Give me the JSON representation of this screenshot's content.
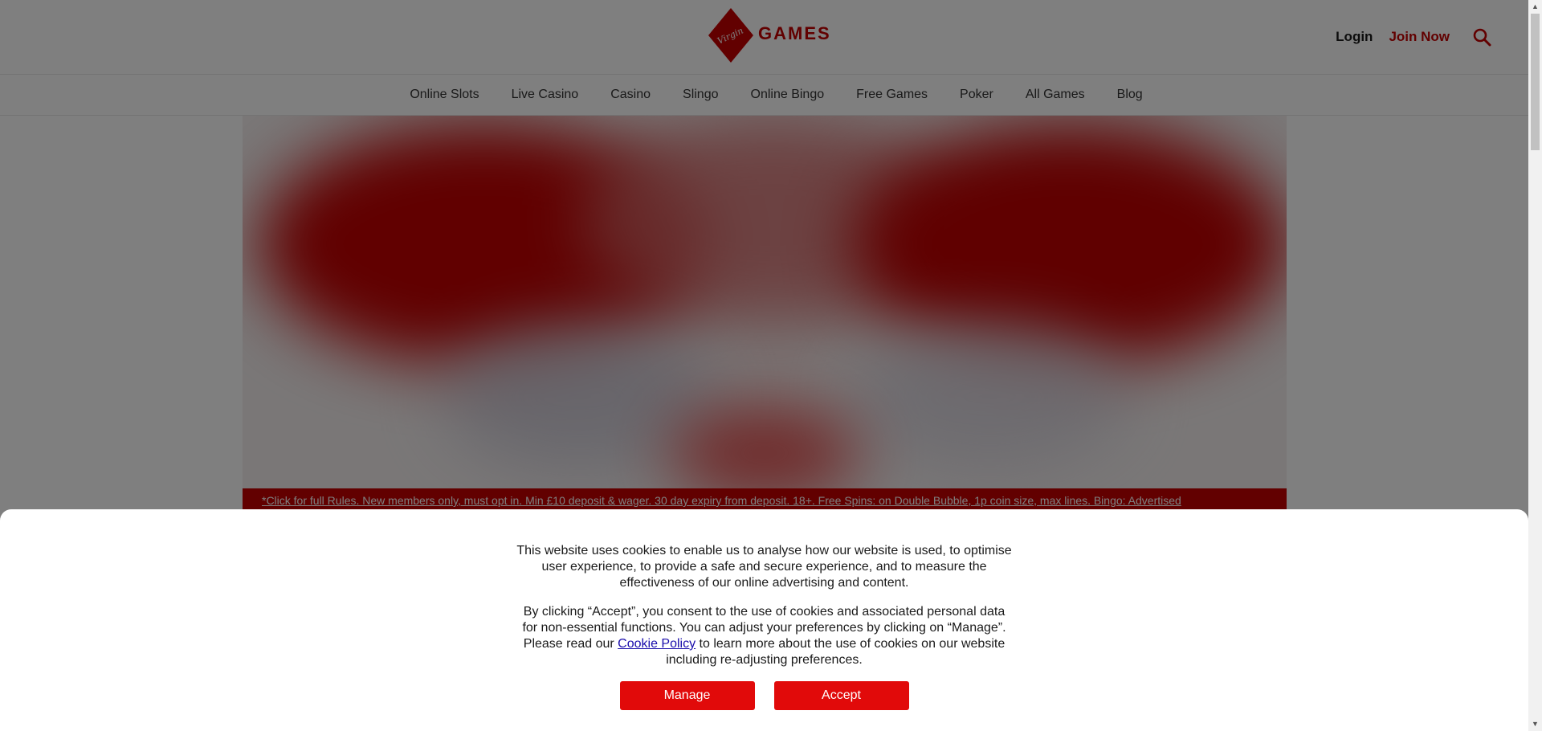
{
  "header": {
    "logo_script": "Virgin",
    "logo_text": "GAMES",
    "login_label": "Login",
    "join_label": "Join Now"
  },
  "nav": {
    "items": [
      {
        "label": "Online Slots"
      },
      {
        "label": "Live Casino"
      },
      {
        "label": "Casino"
      },
      {
        "label": "Slingo"
      },
      {
        "label": "Online Bingo"
      },
      {
        "label": "Free Games"
      },
      {
        "label": "Poker"
      },
      {
        "label": "All Games"
      },
      {
        "label": "Blog"
      }
    ]
  },
  "promo": {
    "text": "*Click for full Rules. New members only, must opt in. Min £10 deposit & wager. 30 day expiry from deposit. 18+. Free Spins: on Double Bubble, 1p coin size, max lines. Bingo: Advertised"
  },
  "cookie": {
    "para1": "This website uses cookies to enable us to analyse how our website is used, to optimise user experience, to provide a safe and secure experience, and to measure the effectiveness of our online advertising and content.",
    "para2_before": "By clicking “Accept”, you consent to the use of cookies and associated personal data for non-essential functions. You can adjust your preferences by clicking on “Manage”. Please read our ",
    "link_label": "Cookie Policy",
    "para2_after": " to learn more about the use of cookies on our website including re-adjusting preferences.",
    "manage_label": "Manage",
    "accept_label": "Accept"
  },
  "colors": {
    "brand_red": "#c40000",
    "button_red": "#e10a0a",
    "link_blue": "#1a0dab"
  },
  "icons": {
    "search": "search-icon",
    "logo": "virgin-diamond-logo"
  }
}
